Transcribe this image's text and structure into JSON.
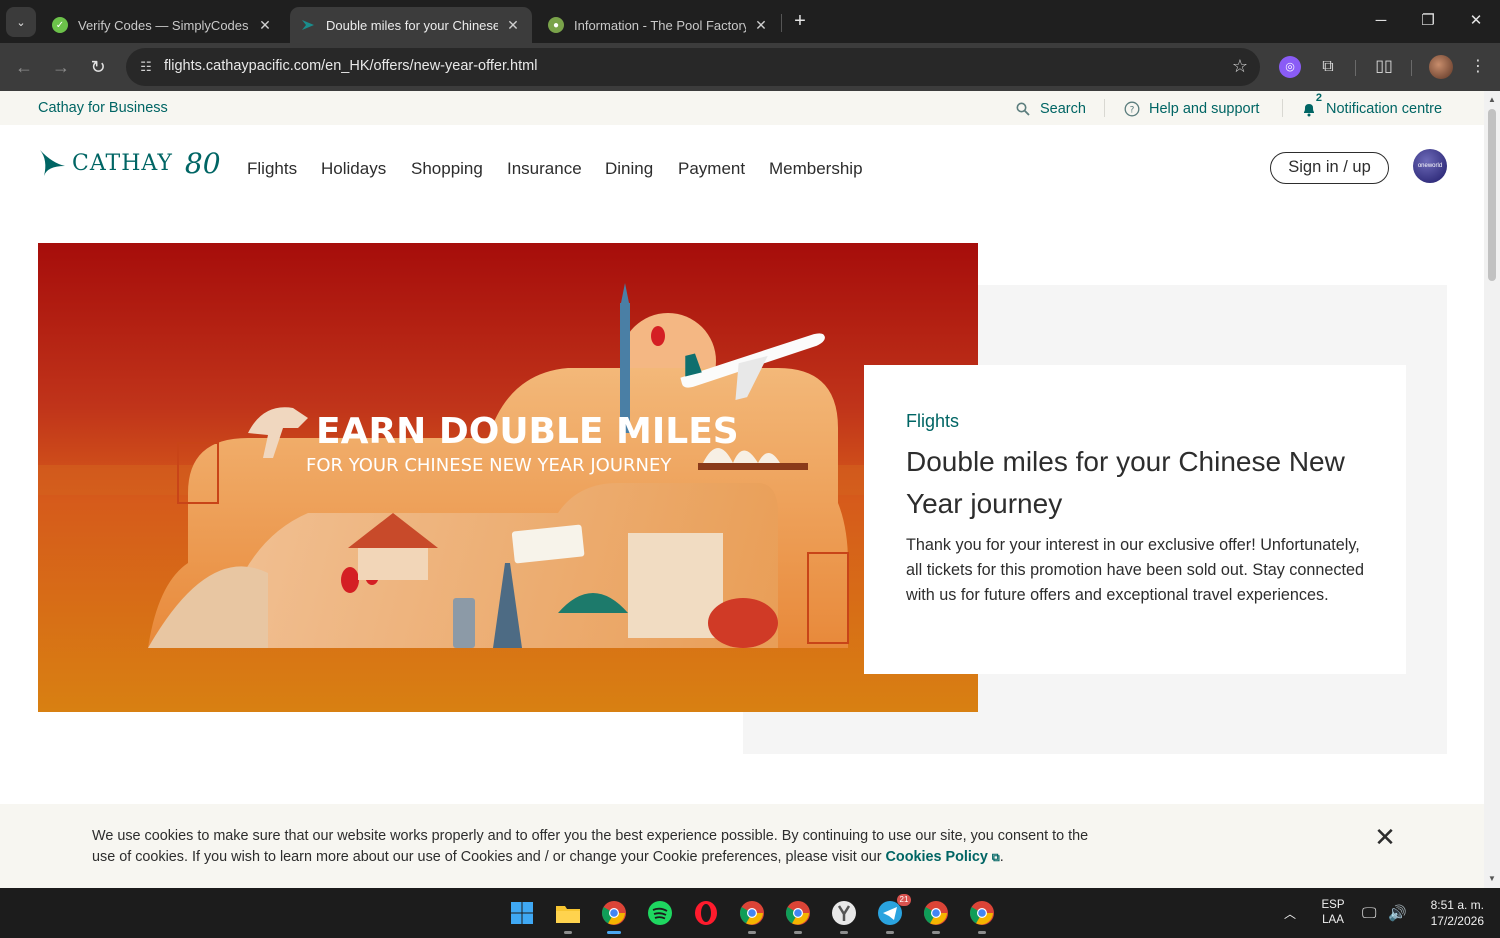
{
  "browser": {
    "tabs": [
      {
        "title": "Verify Codes — SimplyCodes",
        "active": false
      },
      {
        "title": "Double miles for your Chinese N",
        "active": true
      },
      {
        "title": "Information - The Pool Factory",
        "active": false
      }
    ],
    "url": "flights.cathaypacific.com/en_HK/offers/new-year-offer.html"
  },
  "utility_bar": {
    "business_link": "Cathay for Business",
    "search": "Search",
    "help": "Help and support",
    "notifications": "Notification centre",
    "notification_count": "2"
  },
  "nav": {
    "logo_word": "CATHAY",
    "logo_anniversary": "80",
    "links": [
      "Flights",
      "Holidays",
      "Shopping",
      "Insurance",
      "Dining",
      "Payment",
      "Membership"
    ],
    "sign_in": "Sign in / up",
    "alliance_logo": "oneworld"
  },
  "hero": {
    "banner_headline": "EARN DOUBLE MILES",
    "banner_subline": "FOR YOUR CHINESE NEW YEAR JOURNEY",
    "eyebrow": "Flights",
    "title": "Double miles for your Chinese New Year journey",
    "body": "Thank you for your interest in our exclusive offer! Unfortunately, all tickets for this promotion have been sold out. Stay connected with us for future offers and exceptional travel experiences."
  },
  "cookie_banner": {
    "text": "We use cookies to make sure that our website works properly and to offer you the best experience possible. By continuing to use our site, you consent to the use of cookies. If you wish to learn more about our use of Cookies and / or change your Cookie preferences, please visit our",
    "link": "Cookies Policy",
    "end": "."
  },
  "taskbar": {
    "apps": [
      "windows-start",
      "file-explorer",
      "chrome",
      "spotify",
      "opera",
      "chrome-profile-2",
      "chrome-profile-3",
      "chrome-profile-4",
      "telegram",
      "chrome-profile-5",
      "chrome-profile-6"
    ],
    "telegram_badge": "21",
    "language": "ESP",
    "layout": "LAA",
    "time": "8:51 a. m.",
    "date": "17/2/2026"
  },
  "colors": {
    "brand_teal": "#006564",
    "banner_red": "#a8100c",
    "banner_orange": "#d9771a"
  }
}
